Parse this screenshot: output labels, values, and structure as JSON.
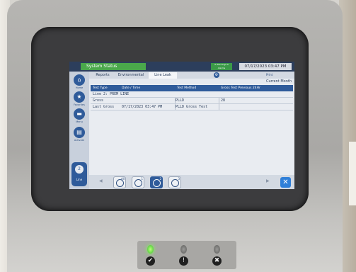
{
  "status_bar": {
    "title": "System Status",
    "alarm_badge": "0 Warnings 0 Alarms",
    "datetime": "07/17/2023 03:47 PM"
  },
  "sidebar": {
    "home_label": "Home",
    "favorites_label": "Favorites",
    "menu_label": "Menu",
    "activate_label": "Activate",
    "line_number": "2",
    "line_label": "Line"
  },
  "tabs": [
    {
      "label": "Reports"
    },
    {
      "label": "Environmental"
    },
    {
      "label": "Line Leak"
    }
  ],
  "print_label": "Print",
  "period": "Current Month",
  "table": {
    "headers": [
      "Test Type",
      "Date / Time",
      "Test Method",
      "Gross Test Previous 24Hr"
    ],
    "group_title": "Line 2: PREM LINE",
    "rows": [
      {
        "type": "Gross",
        "datetime": "",
        "method": "PLLD",
        "prev24": "28"
      },
      {
        "type": "Last Gross",
        "datetime": "07/17/2023 03:47 PM",
        "method": "PLLD Gross Test",
        "prev24": ""
      }
    ]
  },
  "graph_buttons": [
    "All",
    "1",
    "2",
    "3"
  ],
  "panel": {
    "ok_symbol": "✔",
    "warning_symbol": "!",
    "alarm_symbol": "✖"
  },
  "colors": {
    "accent": "#2f5b9a",
    "status_green": "#4aa84b",
    "led_green": "#3bbf2e"
  }
}
